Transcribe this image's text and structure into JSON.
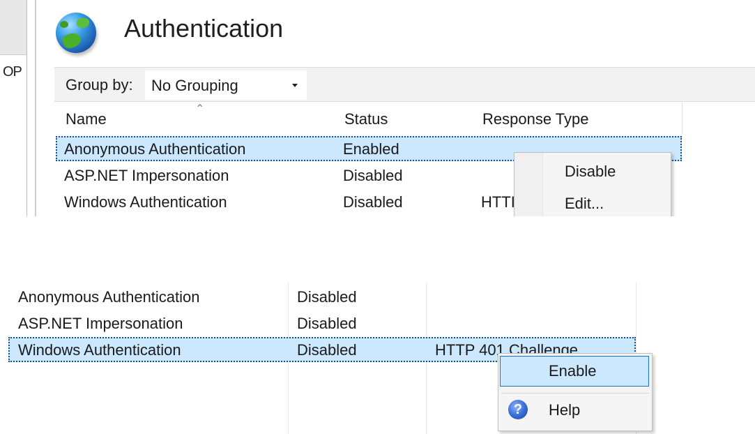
{
  "left_nav": {
    "partial_text": "OP"
  },
  "header": {
    "title": "Authentication",
    "icon": "globe-icon"
  },
  "toolbar": {
    "group_by_label": "Group by:",
    "group_by_value": "No Grouping"
  },
  "columns": {
    "name": "Name",
    "status": "Status",
    "response_type": "Response Type"
  },
  "panel1": {
    "rows": [
      {
        "name": "Anonymous Authentication",
        "status": "Enabled",
        "response": ""
      },
      {
        "name": "ASP.NET Impersonation",
        "status": "Disabled",
        "response": ""
      },
      {
        "name": "Windows Authentication",
        "status": "Disabled",
        "response": "HTTI"
      }
    ],
    "selected_index": 0,
    "context_menu": {
      "items": [
        "Disable",
        "Edit..."
      ]
    }
  },
  "panel2": {
    "rows": [
      {
        "name": "Anonymous Authentication",
        "status": "Disabled",
        "response": ""
      },
      {
        "name": "ASP.NET Impersonation",
        "status": "Disabled",
        "response": ""
      },
      {
        "name": "Windows Authentication",
        "status": "Disabled",
        "response": "HTTP 401 Challenge"
      }
    ],
    "selected_index": 2,
    "context_menu": {
      "items": [
        "Enable",
        "Help"
      ],
      "help_icon_glyph": "?"
    }
  },
  "colors": {
    "selection": "#cce8ff",
    "selection_border": "#1a4e8a",
    "menu_highlight_border": "#1a6fd0"
  }
}
